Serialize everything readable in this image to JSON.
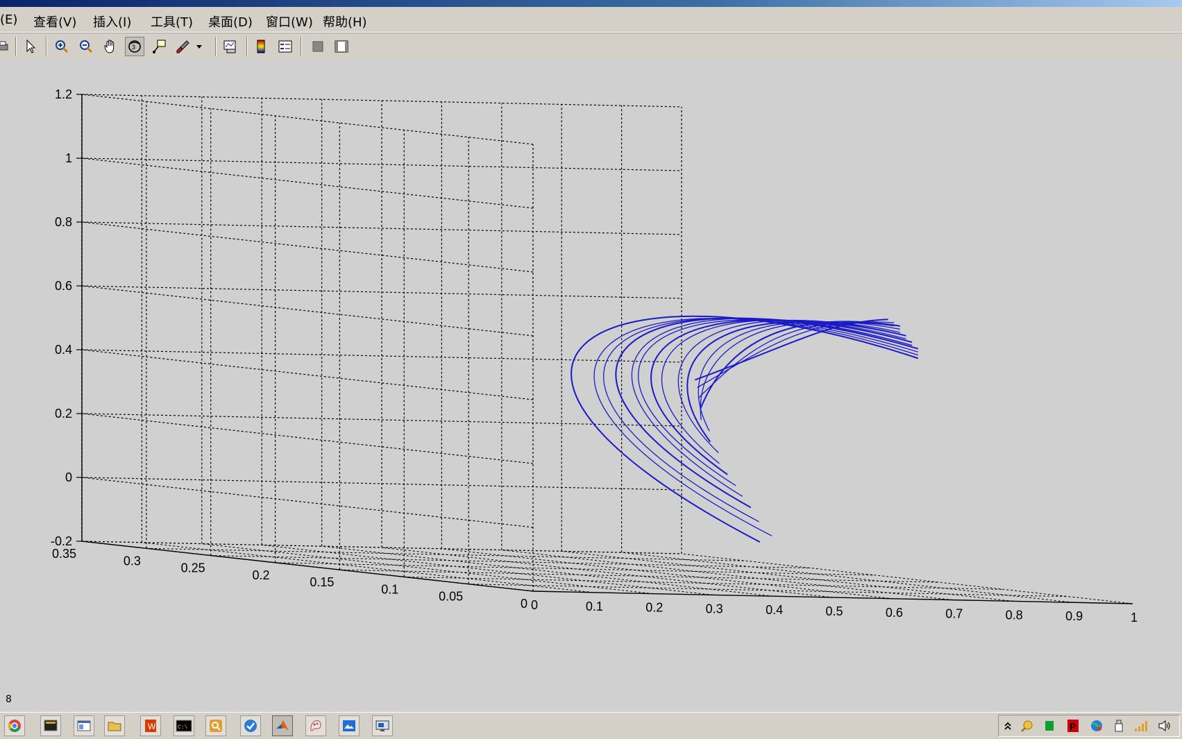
{
  "menu": [
    {
      "label": "(E)"
    },
    {
      "label": "查看(V)"
    },
    {
      "label": "插入(I)"
    },
    {
      "label": "工具(T)"
    },
    {
      "label": "桌面(D)"
    },
    {
      "label": "窗口(W)"
    },
    {
      "label": "帮助(H)"
    }
  ],
  "toolbar": [
    {
      "name": "print-icon"
    },
    {
      "name": "pointer-icon"
    },
    {
      "name": "zoom-in-icon"
    },
    {
      "name": "zoom-out-icon"
    },
    {
      "name": "pan-hand-icon"
    },
    {
      "name": "rotate-3d-icon",
      "pressed": true
    },
    {
      "name": "data-cursor-icon"
    },
    {
      "name": "brush-icon"
    },
    {
      "name": "brush-dropdown-icon"
    },
    {
      "name": "link-plot-icon"
    },
    {
      "name": "colorbar-icon"
    },
    {
      "name": "legend-icon"
    },
    {
      "name": "hide-plot-tools-icon"
    },
    {
      "name": "show-plot-tools-icon"
    }
  ],
  "colors": {
    "curve": "#1a1ac8",
    "figure_bg": "#d0d0d0",
    "window_chrome": "#d4d0c8"
  },
  "chart_data": {
    "type": "line",
    "projection": "3d",
    "title": "",
    "xlabel": "",
    "ylabel": "",
    "zlabel": "",
    "xlim": [
      0,
      0.35
    ],
    "ylim": [
      0,
      1
    ],
    "zlim": [
      -0.2,
      1.2
    ],
    "x_ticks": [
      "0",
      "0.05",
      "0.1",
      "0.15",
      "0.2",
      "0.25",
      "0.3",
      "0.35"
    ],
    "y_ticks": [
      "0",
      "0.1",
      "0.2",
      "0.3",
      "0.4",
      "0.5",
      "0.6",
      "0.7",
      "0.8",
      "0.9",
      "1"
    ],
    "z_ticks": [
      "-0.2",
      "0",
      "0.2",
      "0.4",
      "0.6",
      "0.8",
      "1",
      "1.2"
    ],
    "grid": true,
    "line_color": "#1a1ac8",
    "series": [
      {
        "name": "",
        "points": [
          [
            0.052,
            0.49,
            -0.05
          ],
          [
            0.2,
            0.22,
            0.45
          ],
          [
            0.18,
            0.5,
            0.8
          ],
          [
            0.013,
            0.67,
            0.55
          ]
        ]
      },
      {
        "name": "",
        "points": [
          [
            0.052,
            0.51,
            -0.03
          ],
          [
            0.18,
            0.24,
            0.43
          ],
          [
            0.17,
            0.5,
            0.79
          ],
          [
            0.013,
            0.67,
            0.56
          ]
        ]
      },
      {
        "name": "",
        "points": [
          [
            0.062,
            0.51,
            0.01
          ],
          [
            0.17,
            0.26,
            0.43
          ],
          [
            0.17,
            0.51,
            0.78
          ],
          [
            0.013,
            0.67,
            0.57
          ]
        ]
      },
      {
        "name": "",
        "points": [
          [
            0.073,
            0.52,
            0.05
          ],
          [
            0.16,
            0.28,
            0.45
          ],
          [
            0.16,
            0.51,
            0.77
          ],
          [
            0.013,
            0.67,
            0.58
          ]
        ]
      },
      {
        "name": "",
        "points": [
          [
            0.084,
            0.53,
            0.08
          ],
          [
            0.15,
            0.31,
            0.46
          ],
          [
            0.15,
            0.52,
            0.76
          ],
          [
            0.013,
            0.66,
            0.59
          ]
        ]
      },
      {
        "name": "",
        "points": [
          [
            0.094,
            0.54,
            0.11
          ],
          [
            0.15,
            0.33,
            0.47
          ],
          [
            0.14,
            0.52,
            0.75
          ],
          [
            0.013,
            0.66,
            0.59
          ]
        ]
      },
      {
        "name": "",
        "points": [
          [
            0.105,
            0.55,
            0.14
          ],
          [
            0.14,
            0.35,
            0.48
          ],
          [
            0.13,
            0.53,
            0.74
          ],
          [
            0.013,
            0.66,
            0.6
          ]
        ]
      },
      {
        "name": "",
        "points": [
          [
            0.116,
            0.56,
            0.17
          ],
          [
            0.13,
            0.37,
            0.49
          ],
          [
            0.12,
            0.53,
            0.73
          ],
          [
            0.013,
            0.65,
            0.61
          ]
        ]
      },
      {
        "name": "",
        "points": [
          [
            0.126,
            0.58,
            0.2
          ],
          [
            0.12,
            0.4,
            0.5
          ],
          [
            0.11,
            0.54,
            0.72
          ],
          [
            0.013,
            0.65,
            0.62
          ]
        ]
      },
      {
        "name": "",
        "points": [
          [
            0.137,
            0.59,
            0.23
          ],
          [
            0.11,
            0.42,
            0.51
          ],
          [
            0.1,
            0.54,
            0.71
          ],
          [
            0.013,
            0.65,
            0.62
          ]
        ]
      },
      {
        "name": "",
        "points": [
          [
            0.147,
            0.61,
            0.26
          ],
          [
            0.1,
            0.44,
            0.52
          ],
          [
            0.09,
            0.55,
            0.7
          ],
          [
            0.013,
            0.64,
            0.63
          ]
        ]
      },
      {
        "name": "",
        "points": [
          [
            0.158,
            0.62,
            0.29
          ],
          [
            0.09,
            0.46,
            0.53
          ],
          [
            0.08,
            0.55,
            0.69
          ],
          [
            0.013,
            0.64,
            0.64
          ]
        ]
      },
      {
        "name": "",
        "points": [
          [
            0.168,
            0.64,
            0.32
          ],
          [
            0.08,
            0.49,
            0.54
          ],
          [
            0.07,
            0.56,
            0.68
          ],
          [
            0.013,
            0.64,
            0.65
          ]
        ]
      },
      {
        "name": "",
        "points": [
          [
            0.179,
            0.66,
            0.35
          ],
          [
            0.07,
            0.51,
            0.55
          ],
          [
            0.06,
            0.56,
            0.67
          ],
          [
            0.013,
            0.63,
            0.65
          ]
        ]
      },
      {
        "name": "",
        "points": [
          [
            0.189,
            0.68,
            0.38
          ],
          [
            0.06,
            0.53,
            0.57
          ],
          [
            0.05,
            0.57,
            0.66
          ],
          [
            0.013,
            0.63,
            0.66
          ]
        ]
      },
      {
        "name": "",
        "points": [
          [
            0.2,
            0.7,
            0.4
          ],
          [
            0.05,
            0.55,
            0.58
          ],
          [
            0.04,
            0.58,
            0.65
          ],
          [
            0.013,
            0.62,
            0.67
          ]
        ]
      }
    ]
  },
  "status_text": "8",
  "taskbar": [
    {
      "name": "chrome-icon"
    },
    {
      "name": "terminal-icon"
    },
    {
      "name": "window-icon"
    },
    {
      "name": "folder-icon"
    },
    {
      "name": "office-icon"
    },
    {
      "name": "cmd-icon"
    },
    {
      "name": "search-tool-icon"
    },
    {
      "name": "check-icon"
    },
    {
      "name": "matlab-icon",
      "active": true
    },
    {
      "name": "paint-icon"
    },
    {
      "name": "photo-icon"
    },
    {
      "name": "remote-desktop-icon"
    }
  ],
  "tray": [
    {
      "name": "show-hidden-icons-icon"
    },
    {
      "name": "search-tray-icon"
    },
    {
      "name": "green-app-icon"
    },
    {
      "name": "red-app-icon"
    },
    {
      "name": "globe-icon"
    },
    {
      "name": "usb-icon"
    },
    {
      "name": "signal-icon"
    },
    {
      "name": "volume-icon"
    }
  ]
}
